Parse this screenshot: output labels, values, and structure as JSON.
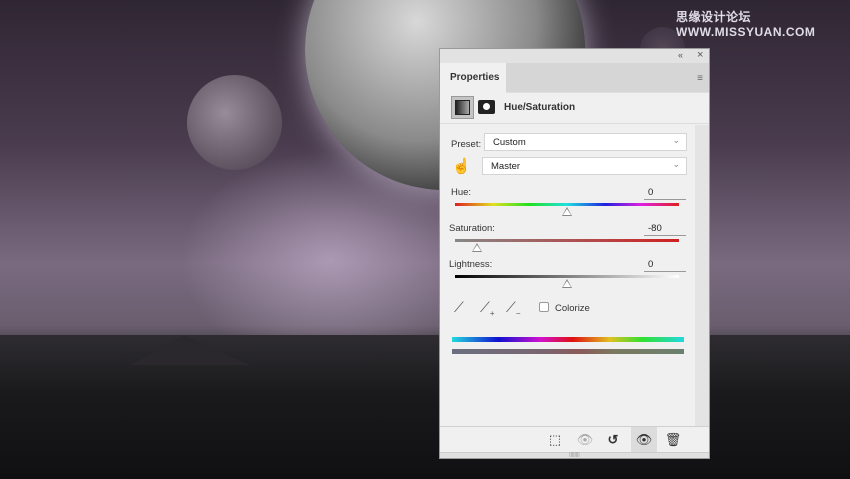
{
  "watermark": "思缘设计论坛 WWW.MISSYUAN.COM",
  "panel": {
    "collapse_icon": "«",
    "close_icon": "×",
    "tab": "Properties",
    "menu_icon": "≡",
    "title": "Hue/Saturation",
    "preset_label": "Preset:",
    "preset_value": "Custom",
    "channel_value": "Master",
    "hue_label": "Hue:",
    "hue_value": "0",
    "hue_fraction": 0.5,
    "saturation_label": "Saturation:",
    "saturation_value": "-80",
    "saturation_fraction": 0.1,
    "lightness_label": "Lightness:",
    "lightness_value": "0",
    "lightness_fraction": 0.5,
    "colorize_label": "Colorize",
    "footer": {
      "clip": "⬚",
      "view_prev": "👁",
      "reset": "↺",
      "visibility": "👁",
      "delete": "🗑"
    }
  }
}
